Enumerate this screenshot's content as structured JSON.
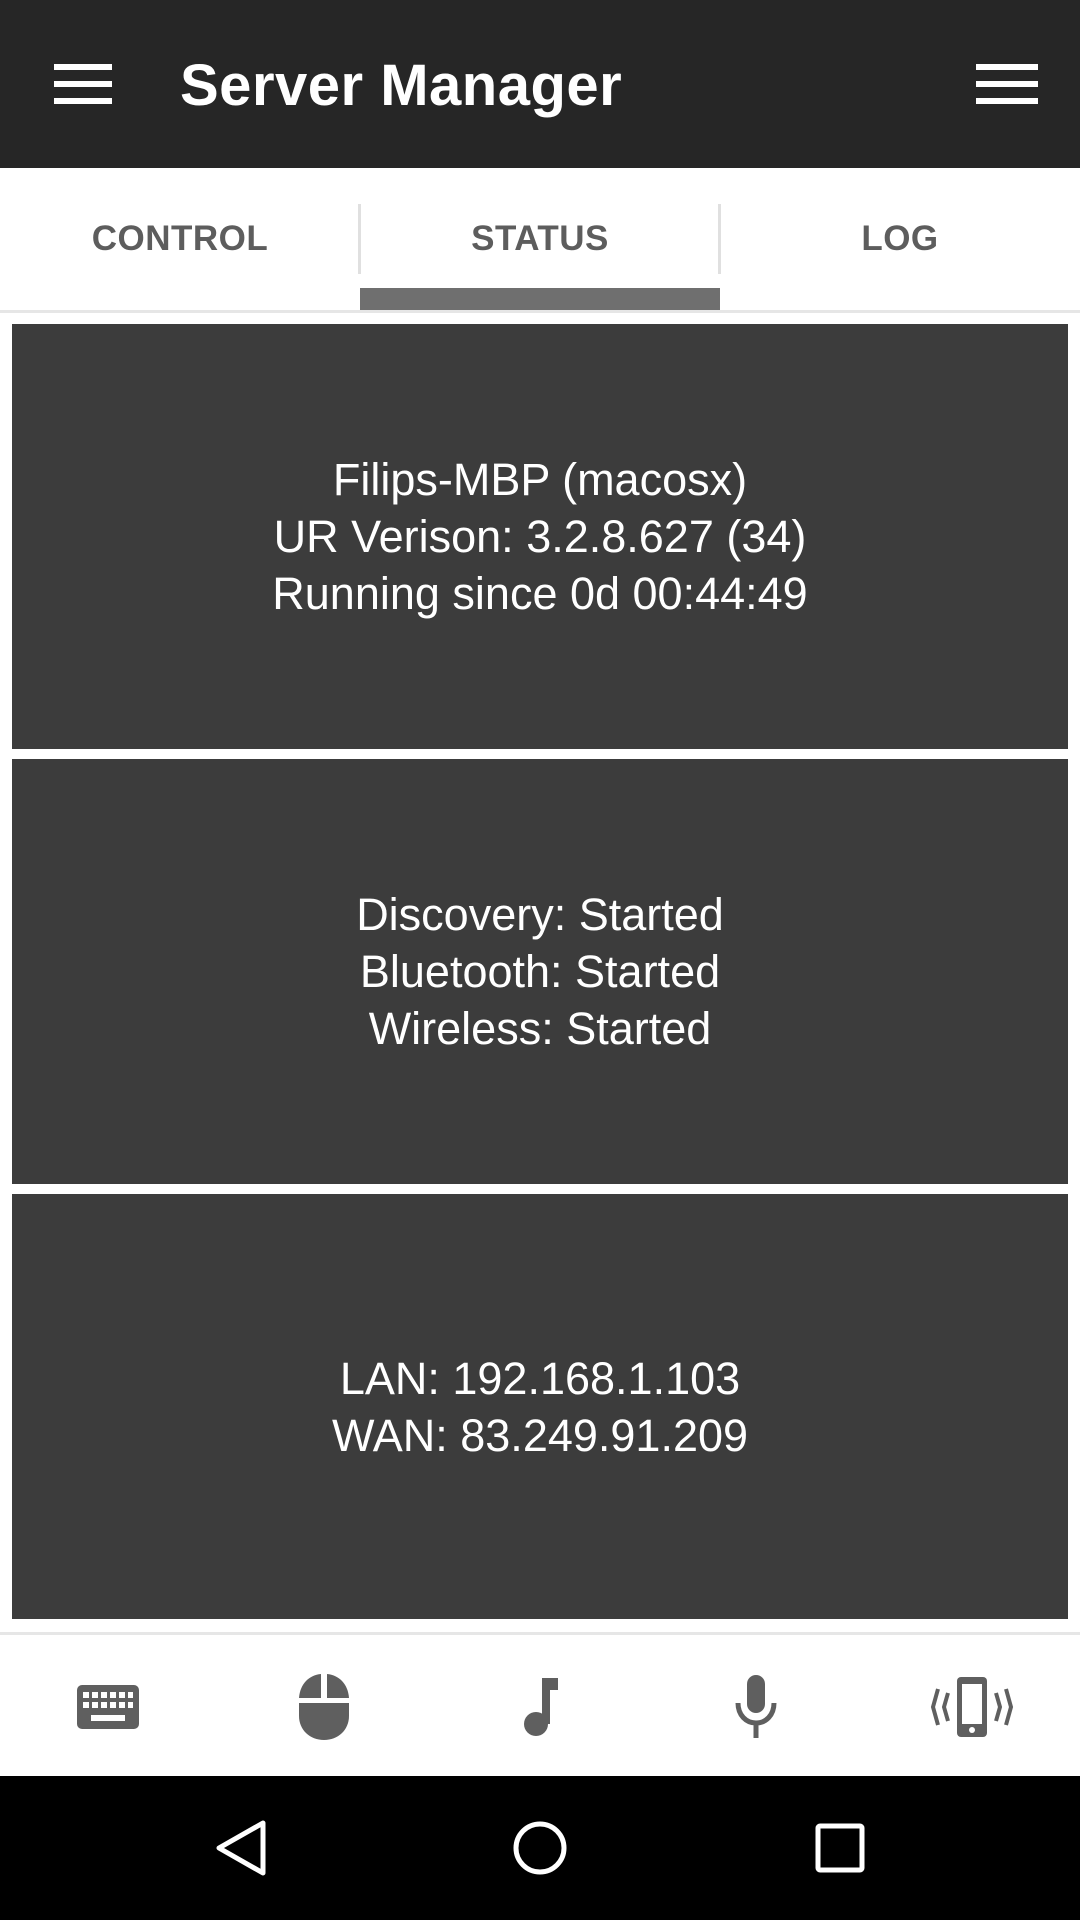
{
  "appbar": {
    "title": "Server Manager",
    "left_icon": "hamburger-menu-icon",
    "right_icon": "overflow-menu-icon"
  },
  "tabs": [
    {
      "label": "CONTROL",
      "selected": false
    },
    {
      "label": "STATUS",
      "selected": true
    },
    {
      "label": "LOG",
      "selected": false
    }
  ],
  "cards": [
    {
      "lines": [
        "Filips-MBP (macosx)",
        "UR Verison: 3.2.8.627 (34)",
        "Running since 0d 00:44:49"
      ]
    },
    {
      "lines": [
        "Discovery: Started",
        "Bluetooth: Started",
        "Wireless: Started"
      ]
    },
    {
      "lines": [
        "LAN: 192.168.1.103",
        "WAN: 83.249.91.209"
      ]
    }
  ],
  "bottom_bar": {
    "icons": [
      "keyboard-icon",
      "mouse-icon",
      "music-note-icon",
      "microphone-icon",
      "phone-vibrate-icon"
    ]
  },
  "system_nav": {
    "icons": [
      "back-icon",
      "home-icon",
      "recents-icon"
    ]
  },
  "colors": {
    "appbar": "#262626",
    "card": "#3c3c3c",
    "tab_indicator": "#6f6f6f",
    "icon_gray": "#5f5f5f",
    "navbar": "#000000"
  }
}
